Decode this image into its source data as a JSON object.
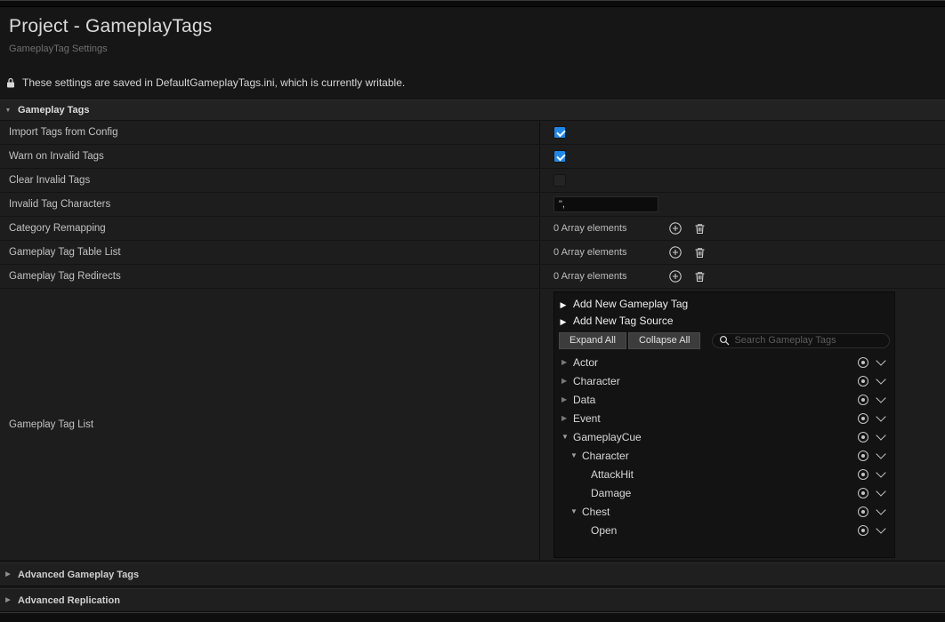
{
  "window": {
    "title": "Project - GameplayTags",
    "subtitle": "GameplayTag Settings",
    "notice": "These settings are saved in DefaultGameplayTags.ini, which is currently writable."
  },
  "sections": [
    {
      "label": "Gameplay Tags",
      "expanded": true
    },
    {
      "label": "Advanced Gameplay Tags",
      "expanded": false
    },
    {
      "label": "Advanced Replication",
      "expanded": false
    }
  ],
  "properties": [
    {
      "label": "Import Tags from Config",
      "type": "checkbox",
      "checked": true
    },
    {
      "label": "Warn on Invalid Tags",
      "type": "checkbox",
      "checked": true
    },
    {
      "label": "Clear Invalid Tags",
      "type": "checkbox",
      "checked": false
    },
    {
      "label": "Invalid Tag Characters",
      "type": "text",
      "value": "\","
    },
    {
      "label": "Category Remapping",
      "type": "array",
      "count_text": "0 Array elements"
    },
    {
      "label": "Gameplay Tag Table List",
      "type": "array",
      "count_text": "0 Array elements"
    },
    {
      "label": "Gameplay Tag Redirects",
      "type": "array",
      "count_text": "0 Array elements"
    }
  ],
  "tag_list": {
    "label": "Gameplay Tag List",
    "add_new_tag_label": "Add New Gameplay Tag",
    "add_new_source_label": "Add New Tag Source",
    "expand_all_label": "Expand All",
    "collapse_all_label": "Collapse All",
    "search_placeholder": "Search Gameplay Tags",
    "tree": [
      {
        "label": "Actor",
        "depth": 0,
        "state": "collapsed"
      },
      {
        "label": "Character",
        "depth": 0,
        "state": "collapsed"
      },
      {
        "label": "Data",
        "depth": 0,
        "state": "collapsed"
      },
      {
        "label": "Event",
        "depth": 0,
        "state": "collapsed"
      },
      {
        "label": "GameplayCue",
        "depth": 0,
        "state": "expanded"
      },
      {
        "label": "Character",
        "depth": 1,
        "state": "expanded"
      },
      {
        "label": "AttackHit",
        "depth": 2,
        "state": "leaf"
      },
      {
        "label": "Damage",
        "depth": 2,
        "state": "leaf"
      },
      {
        "label": "Chest",
        "depth": 1,
        "state": "expanded"
      },
      {
        "label": "Open",
        "depth": 2,
        "state": "leaf"
      }
    ]
  },
  "colors": {
    "accent_blue": "#1f87e8"
  }
}
